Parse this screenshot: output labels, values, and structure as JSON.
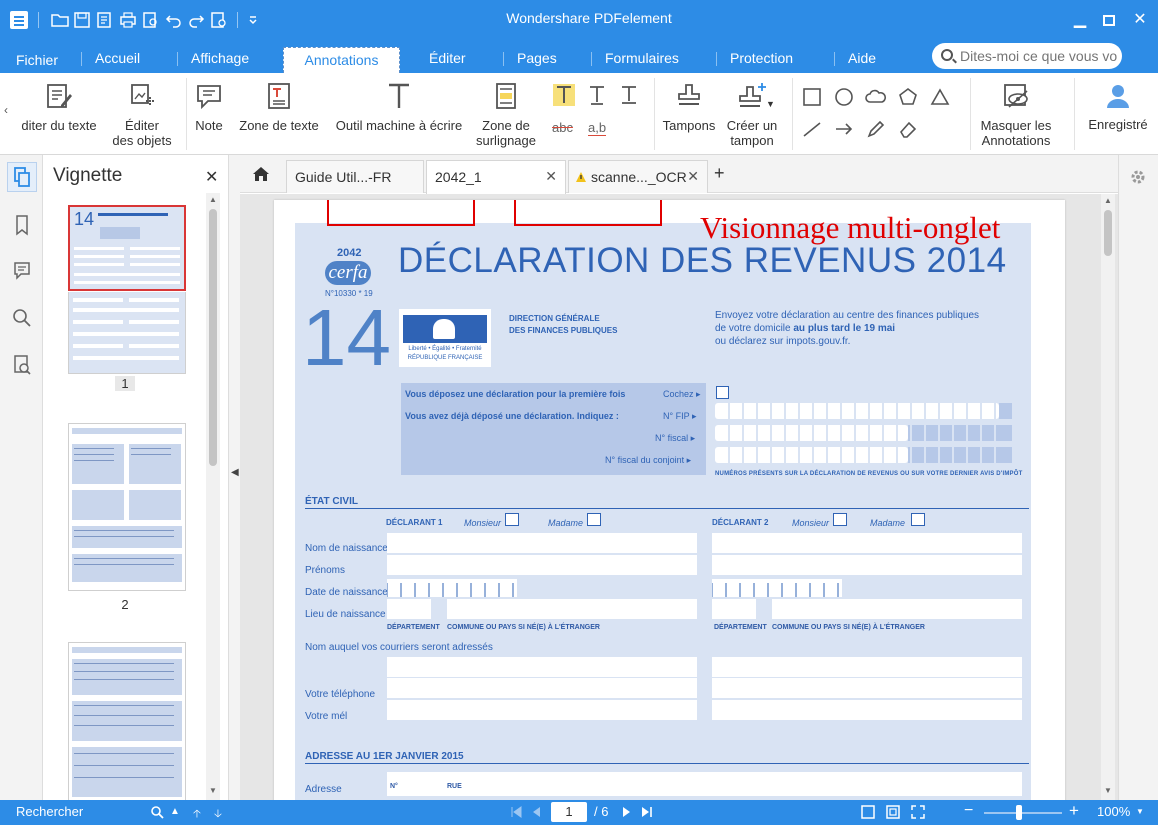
{
  "window": {
    "title": "Wondershare PDFelement",
    "colors": {
      "chrome": "#2d8ce6",
      "annotation": "#e00000",
      "form_bg": "#d9e3f3",
      "form_text": "#2f63b5"
    }
  },
  "quick_access": [
    "folder-icon",
    "save-icon",
    "email-icon",
    "print-icon",
    "preview-icon",
    "undo-icon",
    "redo-icon",
    "settings-doc-icon",
    "customize-icon"
  ],
  "ribbon_tabs": [
    "Fichier",
    "Accueil",
    "Affichage",
    "Annotations",
    "Éditer",
    "Pages",
    "Formulaires",
    "Protection",
    "Aide"
  ],
  "active_tab": "Annotations",
  "search": {
    "placeholder": "Dites-moi ce que vous vo"
  },
  "ribbon": {
    "edit_text": "diter du texte",
    "edit_objects": "Éditer\ndes objets",
    "note": "Note",
    "text_box": "Zone de texte",
    "typewriter": "Outil machine à écrire",
    "highlight_area": "Zone de\nsurlignage",
    "stamps": "Tampons",
    "create_stamp": "Créer un\ntampon",
    "hide_annotations": "Masquer les\nAnnotations",
    "registered": "Enregistré",
    "strike_label": "abc",
    "underline_label": "a,b"
  },
  "sidebar": {
    "title": "Vignette",
    "pages": [
      "1",
      "2"
    ]
  },
  "doc_tabs": [
    {
      "label": "Guide Util...-FR"
    },
    {
      "label": "2042_1"
    },
    {
      "label": "scanne..._OCR"
    }
  ],
  "annotation_text": "Visionnage multi-onglet",
  "form": {
    "year": "2042",
    "brand": "cerfa",
    "cerfa_no": "N°10330 * 19",
    "number": "14",
    "title": "DÉCLARATION DES REVENUS 2014",
    "direction": "DIRECTION GÉNÉRALE\nDES FINANCES PUBLIQUES",
    "marianne": "Liberté • Égalité • Fraternité\nRÉPUBLIQUE FRANÇAISE",
    "send_line1": "Envoyez votre déclaration au centre des finances publiques",
    "send_line2a": "de votre domicile ",
    "send_line2b": "au plus tard le 19 mai",
    "send_line3": "ou déclarez sur impots.gouv.fr.",
    "first_time": "Vous déposez une déclaration pour la première fois",
    "cochez": "Cochez ▸",
    "already": "Vous avez déjà déposé une déclaration. Indiquez :",
    "nfip": "N° FIP ▸",
    "nfiscal": "N° fiscal ▸",
    "nfiscal_conjoint": "N° fiscal du conjoint ▸",
    "numbers_note": "NUMÉROS PRÉSENTS SUR LA DÉCLARATION DE REVENUS OU SUR VOTRE DERNIER AVIS D'IMPÔT",
    "etat_civil": "ÉTAT CIVIL",
    "declarant1": "DÉCLARANT 1",
    "declarant2": "DÉCLARANT 2",
    "monsieur": "Monsieur",
    "madame": "Madame",
    "nom_naissance": "Nom de naissance",
    "prenoms": "Prénoms",
    "date_naissance": "Date de naissance",
    "lieu_naissance": "Lieu de naissance",
    "departement": "DÉPARTEMENT",
    "commune": "COMMUNE OU PAYS SI NÉ(E) À L'ÉTRANGER",
    "nom_courriers": "Nom auquel vos courriers seront adressés",
    "telephone": "Votre téléphone",
    "mel": "Votre mél",
    "adresse_title": "ADRESSE AU 1ER JANVIER 2015",
    "adresse": "Adresse",
    "no": "N°",
    "rue": "RUE"
  },
  "status": {
    "search_label": "Rechercher",
    "current_page": "1",
    "total_pages": "/ 6",
    "zoom": "100%",
    "zoom_fraction": 0.45
  }
}
